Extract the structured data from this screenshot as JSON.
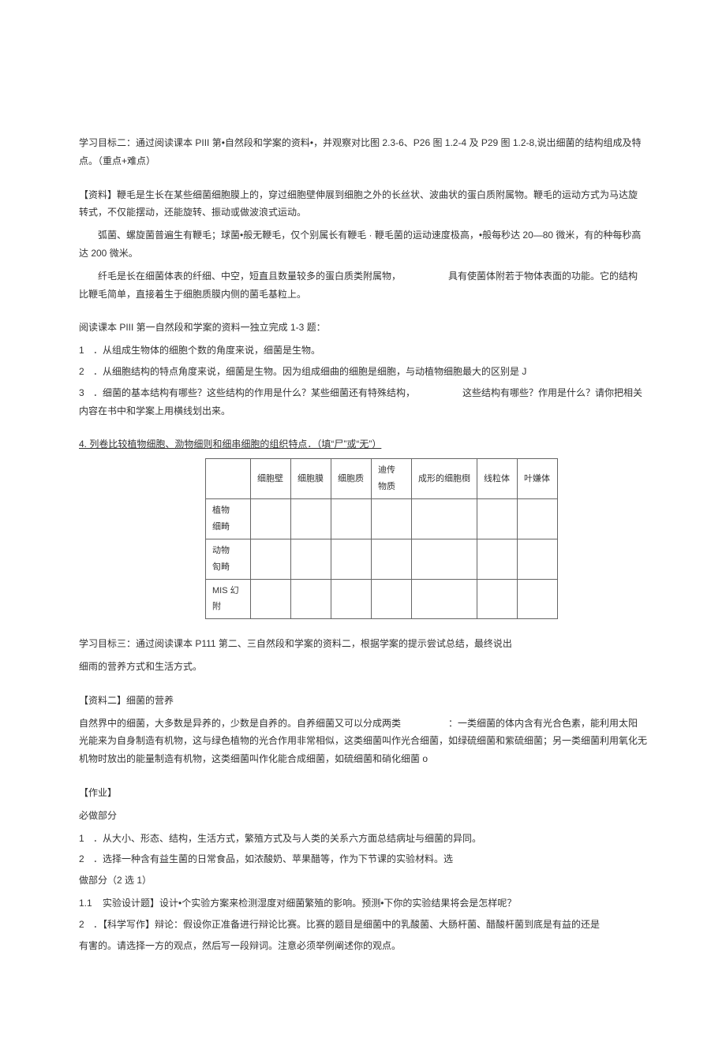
{
  "goal2": {
    "title_prefix": "学习目标二：",
    "text1": "通过阅读课本 PIII 第•自然段和学案的资料•，并观察对比图 2.3-6、P26 图 1.2-4 及 P29 图 1.2-8,说出细菌的结构组成及特点。（重点+难点）"
  },
  "material1": {
    "label": "【资料】",
    "p1": "鞭毛是生长在某些细菌细胞膜上的，穿过细胞壁伸展到细胞之外的长丝状、波曲状的蛋白质附属物。鞭毛的运动方式为马达旋转式，不仅能摆动，还能旋转、振动或做波浪式运动。",
    "p2": "弧菌、螺旋菌普遍生有鞭毛；球菌•般无鞭毛，仅个别属长有鞭毛 · 鞭毛菌的运动速度极高，•般每秒达 20—80 微米，有的种每秒高达 200 微米。",
    "p3_a": "纤毛是长在细菌体表的纤细、中空，短直且数量较多的蛋白质类附属物，",
    "p3_b": "具有使菌体附若于物体表面的功能。它的结构比鞭毛简单，直接着生于细胞质膜内侧的菌毛基粒上。"
  },
  "tasks": {
    "intro": "阅读课本 PIII 第一自然段和学案的资料一独立完成 1-3 题：",
    "n1": "1",
    "t1": "．从组成生物体的细胞个数的角度来说，细菌是生物。",
    "n2": "2",
    "t2": "．从细胞结构的特点角度来说，细菌是生物。因为组成细曲的细胞是细胞，与动植物细胞最大的区别是 J",
    "n3": "3",
    "t3a": "．细菌的基本结构有哪些？这些结构的作用是什么？某些细菌还有特殊结构，",
    "t3b": "这些结构有哪些？作用是什么？请你把相关内容在书中和学案上用横线划出来。",
    "q4": "4. 列卷比较植物细胞、泐物细则和细串细胞的组织特点．（填“尸”或“无”）"
  },
  "table": {
    "headers": [
      "",
      "细胞壁",
      "细胞膜",
      "细胞质",
      "迪传\n物质",
      "成形的细胞椡",
      "线粒体",
      "叶嫌体"
    ],
    "rows": [
      {
        "label": "植物\n细畸"
      },
      {
        "label": "动物\n匌畸"
      },
      {
        "label": "MIS 幻\n附"
      }
    ]
  },
  "goal3": {
    "title_prefix": "学习目标三：",
    "text": "通过阅读课本 P111 第二、三自然段和学案的资料二，根据学案的提示尝试总结，最终说出",
    "text2": "细雨的营养方式和生活方式。"
  },
  "material2": {
    "label": "【资料二】",
    "title": "细菌的营养",
    "p1a": "自然界中的细菌，大多数是异养的，少数是自养的。自养细菌又可以分成两类",
    "p1b": "：一类细菌的体内含有光合色素，能利用太阳光能来为自身制造有机物，这与绿色植物的光合作用非常相似，这类细菌叫作光合细菌，如绿硫细菌和紫硫细菌；另一类细菌利用氧化无机物时放出的能量制造有机物，这类细菌叫作化能合成细菌，如硫细菌和硝化细菌 o"
  },
  "homework": {
    "label": "【作业】",
    "must": "必做部分",
    "n1": "1",
    "h1": "．从大小、形态、结构，生活方式，繁殖方式及与人类的关系六方面总结病址与细菌的异同。",
    "n2": "2",
    "h2": "．选择一种含有益生菌的日常食品，如浓酸奶、苹果醋等，作为下节课的实验材料。选",
    "opt": "做部分（2 选 1）",
    "o1n": "1.1",
    "o1": "实验设计题】设计•个实验方案来检测湿度对细菌繁殖的影响。预测•下你的实验结果将会是怎样呢？",
    "o2n": "2",
    "o2a": "．【科学写作】辩论：假设你正准备进行辩论比赛。比赛的题目是细菌中的乳酸菌、大肠杆菌、醋酸杆菌到底是有益的还是",
    "o2b": "有害的。请选择一方的观点，然后写一段辩词。注意必须举例阐述你的观点。"
  }
}
